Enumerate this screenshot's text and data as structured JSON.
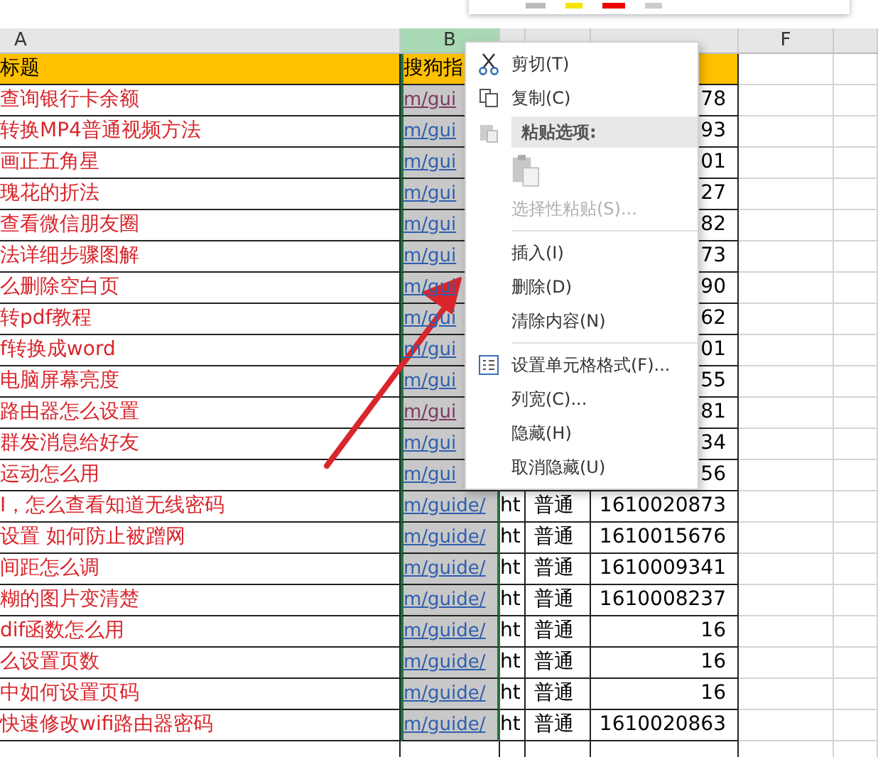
{
  "columns": [
    {
      "letter": "A",
      "selected": false
    },
    {
      "letter": "B",
      "selected": true
    },
    {
      "letter": "F",
      "selected": false
    }
  ],
  "header_row": {
    "title": "标题",
    "link": "搜狗指"
  },
  "rows": [
    {
      "title": "查询银行卡余额",
      "link": "m/gui",
      "visited": true,
      "number": "78"
    },
    {
      "title": "转换MP4普通视频方法",
      "link": "m/gui",
      "visited": false,
      "number": "93"
    },
    {
      "title": "画正五角星",
      "link": "m/gui",
      "visited": false,
      "number": "01"
    },
    {
      "title": "瑰花的折法",
      "link": "m/gui",
      "visited": false,
      "number": "27"
    },
    {
      "title": "查看微信朋友圈",
      "link": "m/gui",
      "visited": false,
      "number": "82"
    },
    {
      "title": "法详细步骤图解",
      "link": "m/gui",
      "visited": false,
      "number": "73"
    },
    {
      "title": "么删除空白页",
      "link": "m/gui",
      "visited": false,
      "number": "90"
    },
    {
      "title": "转pdf教程",
      "link": "m/gui",
      "visited": false,
      "number": "62"
    },
    {
      "title": "f转换成word",
      "link": "m/gui",
      "visited": false,
      "number": "01"
    },
    {
      "title": "电脑屏幕亮度",
      "link": "m/gui",
      "visited": false,
      "number": "55"
    },
    {
      "title": "路由器怎么设置",
      "link": "m/gui",
      "visited": true,
      "number": "81"
    },
    {
      "title": "群发消息给好友",
      "link": "m/gui",
      "visited": false,
      "number": "34"
    },
    {
      "title": "运动怎么用",
      "link": "m/gui",
      "visited": false,
      "number": "56"
    },
    {
      "title": "I，怎么查看知道无线密码",
      "link": "m/guide/",
      "visited": false,
      "url": "ht",
      "type": "普通",
      "number": "1610020873"
    },
    {
      "title": "设置 如何防止被蹭网",
      "link": "m/guide/",
      "visited": false,
      "url": "ht",
      "type": "普通",
      "number": "1610015676"
    },
    {
      "title": "间距怎么调",
      "link": "m/guide/",
      "visited": false,
      "url": "ht",
      "type": "普通",
      "number": "1610009341"
    },
    {
      "title": "糊的图片变清楚",
      "link": "m/guide/",
      "visited": false,
      "url": "ht",
      "type": "普通",
      "number": "1610008237"
    },
    {
      "title": "dif函数怎么用",
      "link": "m/guide/",
      "visited": false,
      "url": "ht",
      "type": "普通",
      "number": "16"
    },
    {
      "title": "么设置页数",
      "link": "m/guide/",
      "visited": false,
      "url": "ht",
      "type": "普通",
      "number": "16"
    },
    {
      "title": "中如何设置页码",
      "link": "m/guide/",
      "visited": false,
      "url": "ht",
      "type": "普通",
      "number": "16"
    },
    {
      "title": "快速修改wifi路由器密码",
      "link": "m/guide/",
      "visited": false,
      "url": "ht",
      "type": "普通",
      "number": "1610020863"
    }
  ],
  "context_menu": {
    "items": [
      {
        "kind": "command",
        "label": "剪切(T)",
        "disabled": false
      },
      {
        "kind": "command",
        "label": "复制(C)",
        "disabled": false
      },
      {
        "kind": "header",
        "label": "粘贴选项:"
      },
      {
        "kind": "paste-option"
      },
      {
        "kind": "command",
        "label": "选择性粘贴(S)...",
        "disabled": true
      },
      {
        "kind": "separator"
      },
      {
        "kind": "command",
        "label": "插入(I)",
        "disabled": false
      },
      {
        "kind": "command",
        "label": "删除(D)",
        "disabled": false
      },
      {
        "kind": "command",
        "label": "清除内容(N)",
        "disabled": false
      },
      {
        "kind": "separator"
      },
      {
        "kind": "command",
        "label": "设置单元格格式(F)...",
        "disabled": false
      },
      {
        "kind": "command",
        "label": "列宽(C)...",
        "disabled": false
      },
      {
        "kind": "command",
        "label": "隐藏(H)",
        "disabled": false
      },
      {
        "kind": "command",
        "label": "取消隐藏(U)",
        "disabled": false
      }
    ]
  }
}
